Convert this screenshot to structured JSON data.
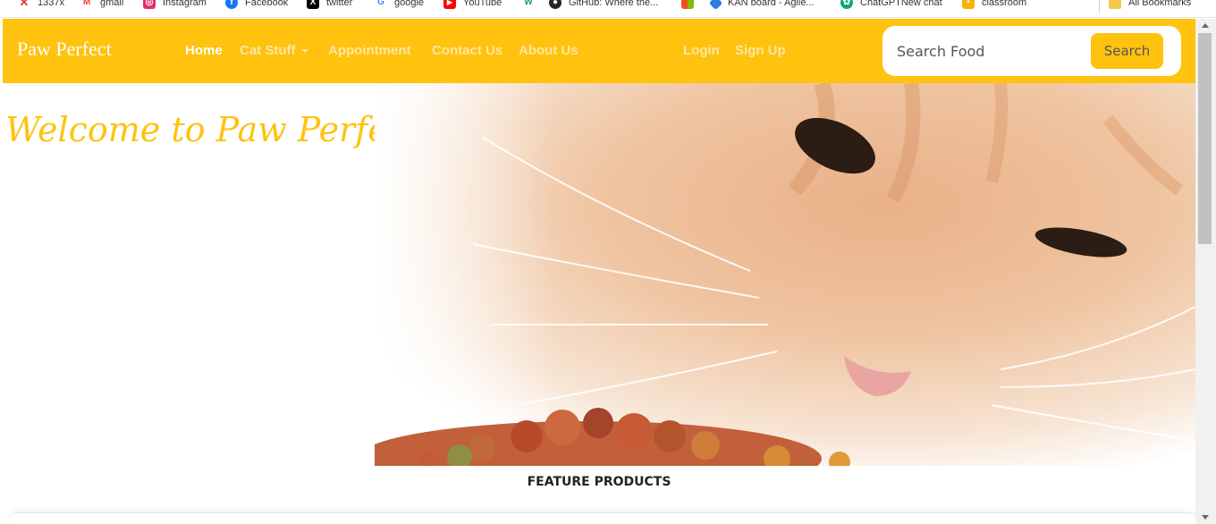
{
  "bookmarks": [
    {
      "label": "1337x",
      "icon": "x-red-icon",
      "color": "#e53935"
    },
    {
      "label": "gmail",
      "icon": "gmail-icon",
      "color": "#ea4335"
    },
    {
      "label": "Instagram",
      "icon": "instagram-icon",
      "color": "#e1306c"
    },
    {
      "label": "Facebook",
      "icon": "facebook-icon",
      "color": "#1877f2"
    },
    {
      "label": "twitter",
      "icon": "x-icon",
      "color": "#000000"
    },
    {
      "label": "google",
      "icon": "google-icon",
      "color": "#4285f4"
    },
    {
      "label": "YouTube",
      "icon": "youtube-icon",
      "color": "#ff0000"
    },
    {
      "label": "",
      "icon": "w-green-icon",
      "color": "#1a9f5b"
    },
    {
      "label": "GitHub: Where the...",
      "icon": "github-icon",
      "color": "#24292e"
    },
    {
      "label": "",
      "icon": "windows-icon",
      "color": "#f25022"
    },
    {
      "label": "KAN board - Agile...",
      "icon": "kan-board-icon",
      "color": "#2f7be6"
    },
    {
      "label": "ChatGPTNew chat",
      "icon": "chatgpt-icon",
      "color": "#10a37f"
    },
    {
      "label": "classroom",
      "icon": "classroom-icon",
      "color": "#f6b400"
    },
    {
      "label": "All Bookmarks",
      "icon": "folder-icon",
      "color": "#f2c94c"
    }
  ],
  "navbar": {
    "brand": "Paw Perfect",
    "links": [
      "Home",
      "Cat Stuff",
      "Appointment",
      "Contact Us",
      "About Us"
    ],
    "auth": [
      "Login",
      "Sign Up"
    ],
    "search_placeholder": "Search Food",
    "search_button": "Search"
  },
  "hero": {
    "title": "Welcome to Paw Perfect"
  },
  "section": {
    "feature_title": "FEATURE PRODUCTS"
  },
  "colors": {
    "accent": "#ffc20e",
    "nav_link_inactive": "#fde7a4"
  }
}
